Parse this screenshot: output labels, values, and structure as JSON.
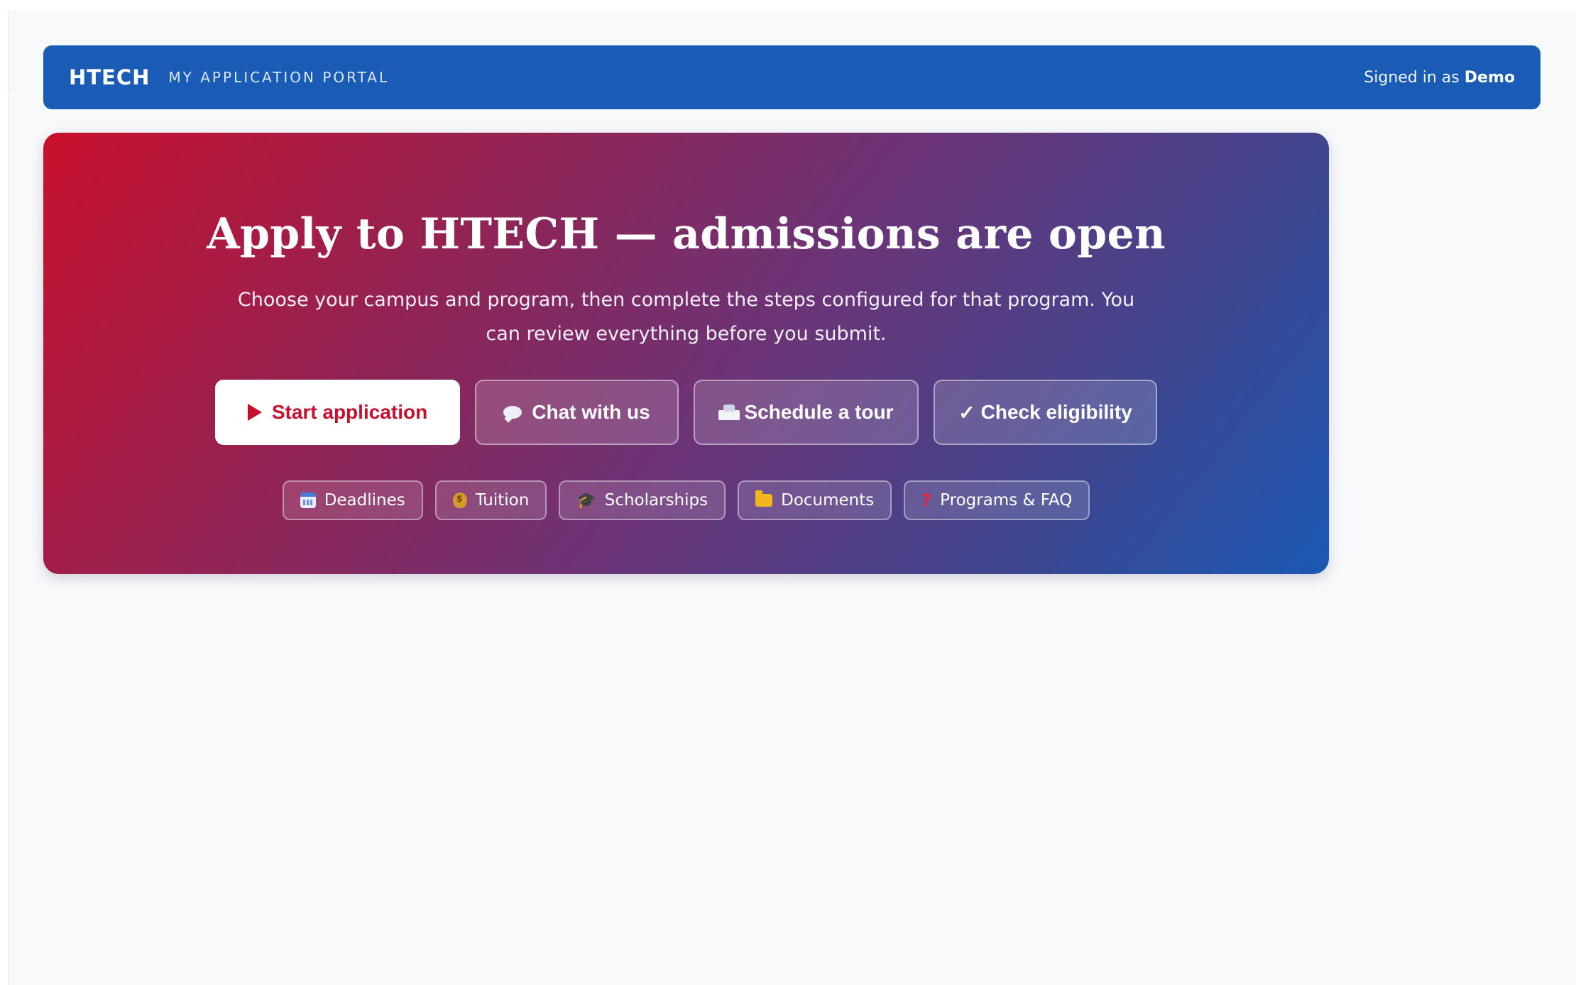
{
  "header": {
    "brand": "HTECH",
    "portal_label": "MY APPLICATION PORTAL",
    "signed_in_prefix": "Signed in as",
    "user_name": "Demo",
    "bg_color": "#1a5bb5"
  },
  "hero": {
    "title": "Apply to HTECH — admissions are open",
    "subtitle": "Choose your campus and program, then complete the steps configured for that program. You can review everything before you submit.",
    "gradient": [
      "#c8112d",
      "#6a3477",
      "#1a58b4"
    ],
    "actions": [
      {
        "label": "Start application",
        "icon": "play-icon",
        "primary": true
      },
      {
        "label": "Chat with us",
        "icon": "speech-bubble-icon",
        "primary": false
      },
      {
        "label": "Schedule a tour",
        "icon": "school-icon",
        "primary": false
      },
      {
        "label": "Check eligibility",
        "icon": "check-icon",
        "glyph": "✓",
        "primary": false
      }
    ],
    "chips": [
      {
        "label": "Deadlines",
        "icon": "calendar-icon"
      },
      {
        "label": "Tuition",
        "icon": "money-bag-icon"
      },
      {
        "label": "Scholarships",
        "icon": "graduation-cap-icon",
        "glyph": "🎓"
      },
      {
        "label": "Documents",
        "icon": "folder-icon"
      },
      {
        "label": "Programs & FAQ",
        "icon": "question-mark-icon",
        "glyph": "?"
      }
    ]
  }
}
